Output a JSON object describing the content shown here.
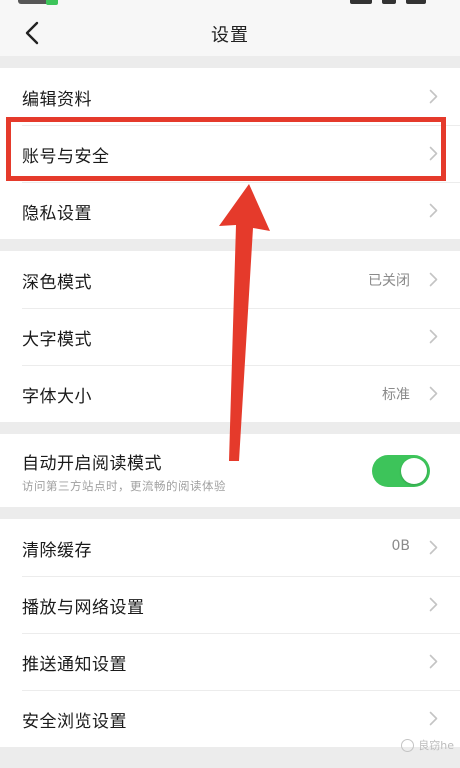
{
  "nav": {
    "title": "设置"
  },
  "groups": [
    {
      "rows": [
        {
          "label": "编辑资料"
        },
        {
          "label": "账号与安全"
        },
        {
          "label": "隐私设置"
        }
      ]
    },
    {
      "rows": [
        {
          "label": "深色模式",
          "value": "已关闭"
        },
        {
          "label": "大字模式"
        },
        {
          "label": "字体大小",
          "value": "标准"
        }
      ]
    },
    {
      "rows": [
        {
          "label": "自动开启阅读模式",
          "subtitle": "访问第三方站点时，更流畅的阅读体验",
          "toggle_on": true
        }
      ]
    },
    {
      "rows": [
        {
          "label": "清除缓存",
          "value": "0B"
        },
        {
          "label": "播放与网络设置"
        },
        {
          "label": "推送通知设置"
        },
        {
          "label": "安全浏览设置"
        }
      ]
    }
  ],
  "annotation": {
    "highlighted_row": "账号与安全",
    "color": "#e53a2b"
  },
  "colors": {
    "accent": "#3dc45a",
    "annotation": "#e53a2b"
  },
  "watermark": {
    "text": "良窃he"
  }
}
